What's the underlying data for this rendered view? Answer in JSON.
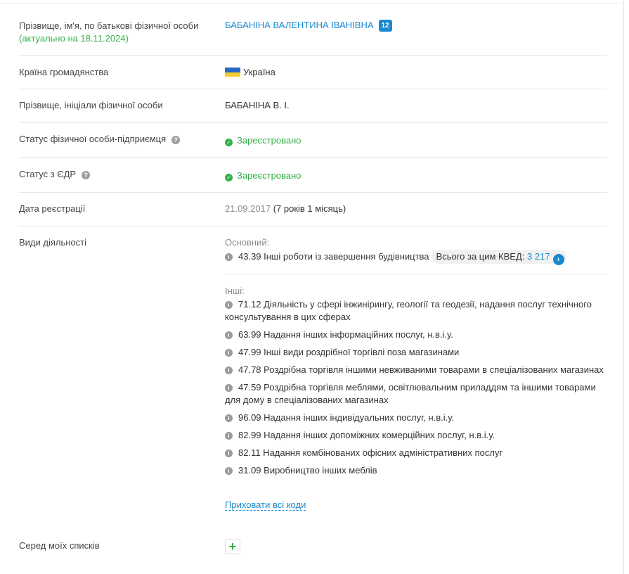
{
  "fields": {
    "name_label": "Прізвище, ім'я, по батькові фізичної особи",
    "name_actual": "(актуально на 18.11.2024)",
    "name_value": "БАБАНІНА ВАЛЕНТИНА ІВАНІВНА",
    "name_badge": "12",
    "country_label": "Країна громадянства",
    "country_value": "Україна",
    "initials_label": "Прізвище, ініціали фізичної особи",
    "initials_value": "БАБАНІНА В. І.",
    "fop_status_label": "Статус фізичної особи-підприємця",
    "fop_status_value": "Зареєстровано",
    "edr_status_label": "Статус з ЄДР",
    "edr_status_value": "Зареєстровано",
    "reg_date_label": "Дата реєстрації",
    "reg_date_value": "21.09.2017",
    "reg_date_duration": "(7 років 1 місяць)",
    "activities_label": "Види діяльності",
    "lists_label": "Серед моїх списків"
  },
  "activities": {
    "main_heading": "Основний:",
    "main_item": "43.39 Інші роботи із завершення будівництва",
    "kved_total_label": "Всього за цим КВЕД:",
    "kved_total_count": "3 217",
    "other_heading": "Інші:",
    "other_items": [
      "71.12 Діяльність у сфері інжинірингу, геології та геодезії, надання послуг технічного консультування в цих сферах",
      "63.99 Надання інших інформаційних послуг, н.в.і.у.",
      "47.99 Інші види роздрібної торгівлі поза магазинами",
      "47.78 Роздрібна торгівля іншими невживаними товарами в спеціалізованих магазинах",
      "47.59 Роздрібна торгівля меблями, освітлювальним приладдям та іншими товарами для дому в спеціалізованих магазинах",
      "96.09 Надання інших індивідуальних послуг, н.в.і.у.",
      "82.99 Надання інших допоміжних комерційних послуг, н.в.і.у.",
      "82.11 Надання комбінованих офісних адміністративних послуг",
      "31.09 Виробництво інших меблів"
    ],
    "hide_all_codes": "Приховати всі коди"
  },
  "icons": {
    "badge": "counter-badge",
    "flag": "ukraine-flag-icon",
    "question": "question-icon",
    "check": "check-circle-icon",
    "info": "info-icon",
    "go": "chevron-right-icon",
    "plus": "plus-icon"
  },
  "colors": {
    "link": "#1a8ad0",
    "green": "#34b04a"
  }
}
